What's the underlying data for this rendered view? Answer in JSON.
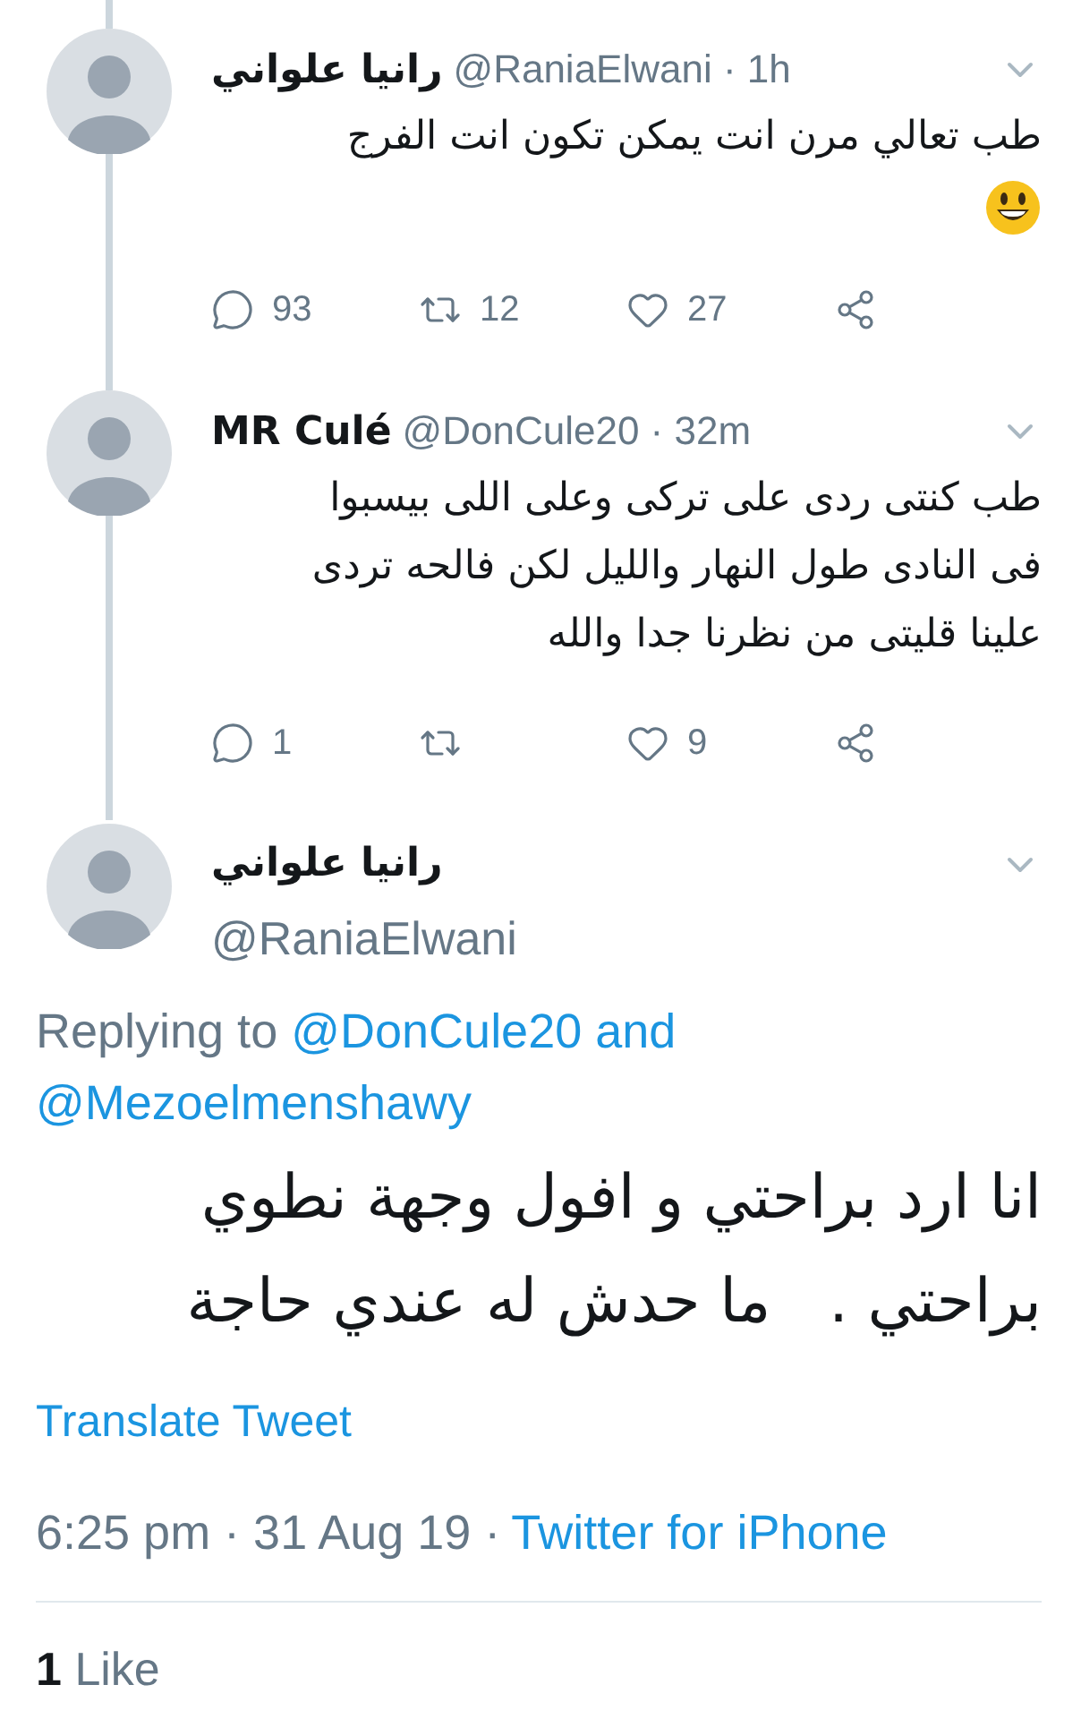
{
  "tweets": [
    {
      "kind": "reply",
      "name": "رانيا علواني",
      "handle_time": "@RaniaElwani · 1h",
      "lines": [
        "طب تعالي مرن انت يمكن تكون انت الفرج"
      ],
      "emoji": true,
      "reply_count": "93",
      "retweet_count": "12",
      "like_count": "27"
    },
    {
      "kind": "reply",
      "name": "MR Culé",
      "handle_time": "@DonCule20 · 32m",
      "lines": [
        "طب كنتى ردى على تركى وعلى اللى بيسبوا",
        "فى النادى طول النهار والليل لكن فالحه تردى",
        "علينا قليتى من نظرنا جدا والله"
      ],
      "emoji": false,
      "reply_count": "1",
      "like_count": "9"
    }
  ],
  "main_tweet": {
    "name": "رانيا علواني",
    "handle": "@RaniaElwani",
    "replying_prefix": "Replying to",
    "mentions": [
      "@DonCule20",
      "and",
      "@Mezoelmenshawy"
    ],
    "lines": [
      "انا ارد براحتي و افول وجهة نطوي",
      "براحتي .   ما حدش له عندي حاجة"
    ],
    "translate": "Translate Tweet",
    "timestamp": "6:25 pm · 31 Aug 19 ·",
    "source": "Twitter for iPhone",
    "likes": "**1** Like"
  }
}
